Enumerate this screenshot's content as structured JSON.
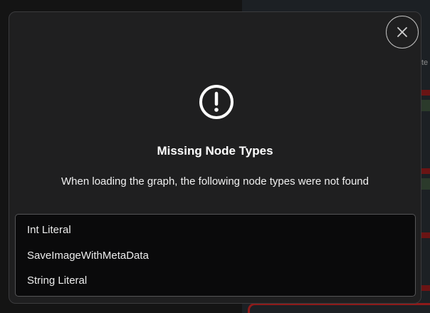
{
  "background": {
    "edge_text": "te"
  },
  "dialog": {
    "title": "Missing Node Types",
    "message": "When loading the graph, the following node types were not found",
    "missing_nodes": [
      "Int Literal",
      "SaveImageWithMetaData",
      "String Literal"
    ],
    "close_icon": "close-icon",
    "alert_icon": "exclamation-circle-icon"
  },
  "colors": {
    "dialog_bg": "#1f1f20",
    "list_bg": "#0a0a0b",
    "text": "#ffffff"
  }
}
